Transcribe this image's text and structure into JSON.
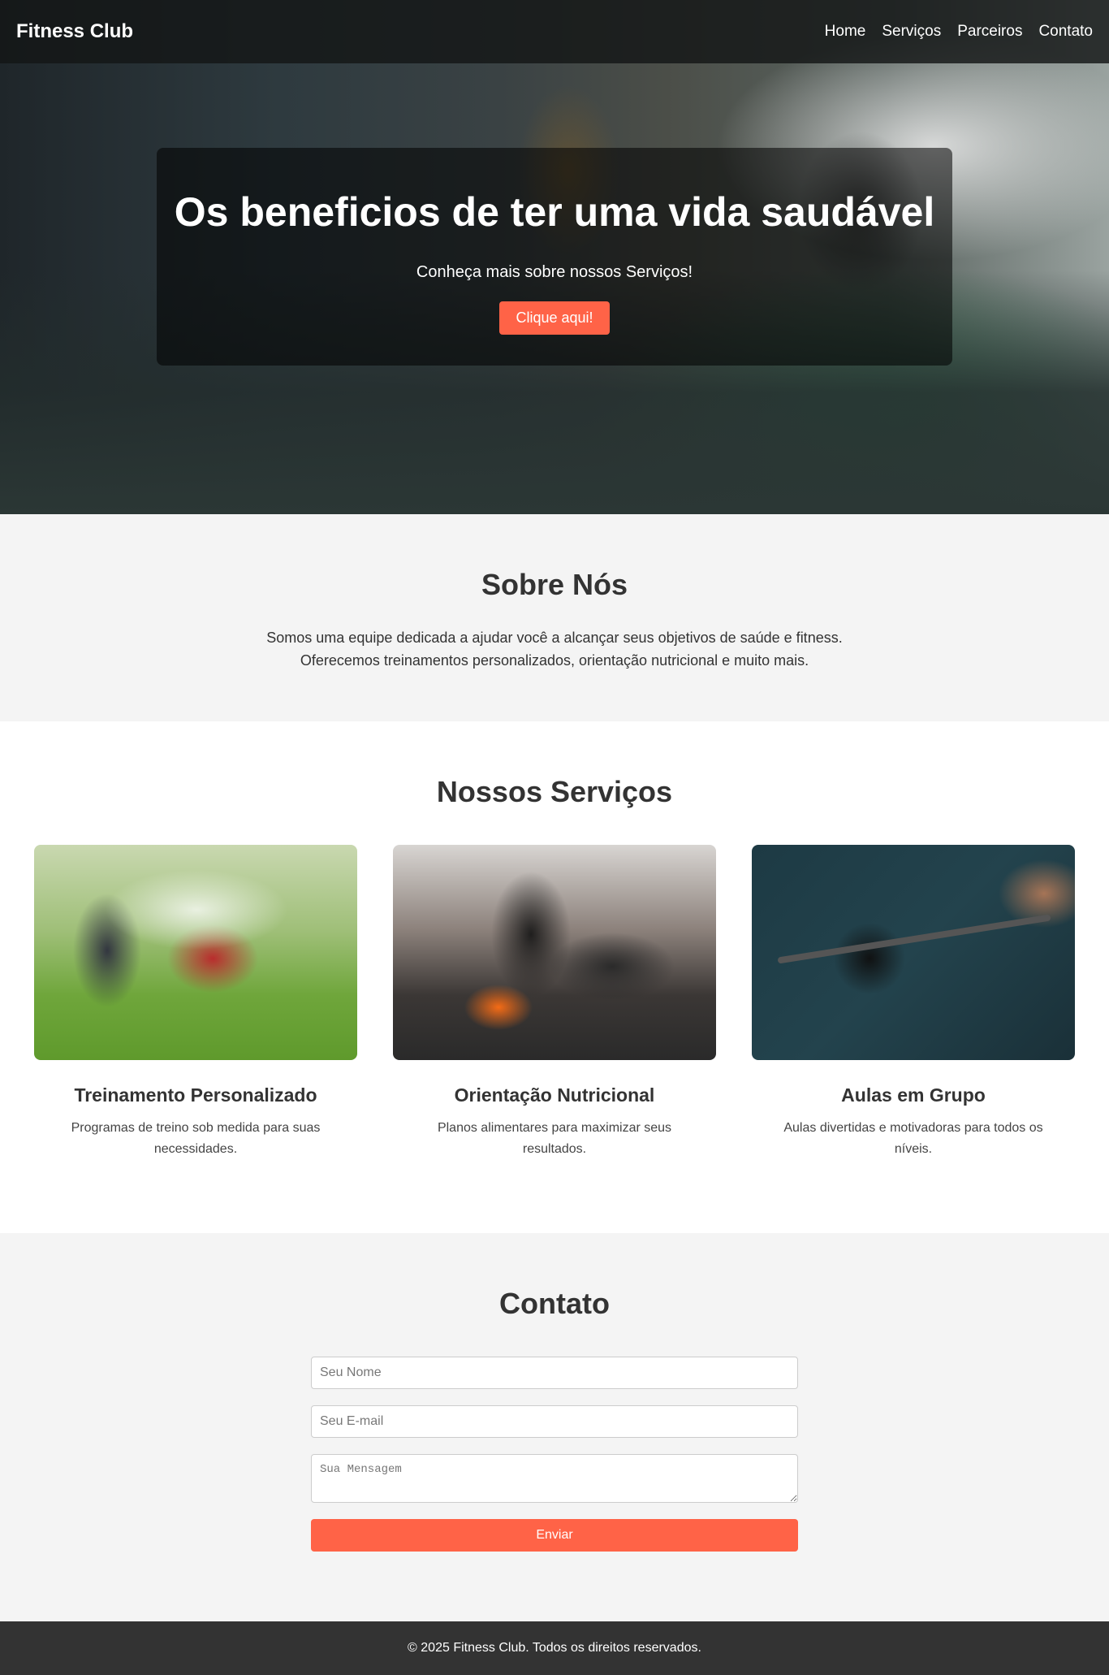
{
  "nav": {
    "brand": "Fitness Club",
    "links": [
      "Home",
      "Serviços",
      "Parceiros",
      "Contato"
    ]
  },
  "hero": {
    "title": "Os beneficios de ter uma vida saudável",
    "subtitle": "Conheça mais sobre nossos Serviços!",
    "button": "Clique aqui!"
  },
  "about": {
    "title": "Sobre Nós",
    "line1": "Somos uma equipe dedicada a ajudar você a alcançar seus objetivos de saúde e fitness.",
    "line2": "Oferecemos treinamentos personalizados, orientação nutricional e muito mais."
  },
  "services": {
    "title": "Nossos Serviços",
    "cards": [
      {
        "title": "Treinamento Personalizado",
        "text": "Programas de treino sob medida para suas necessidades."
      },
      {
        "title": "Orientação Nutricional",
        "text": "Planos alimentares para maximizar seus resultados."
      },
      {
        "title": "Aulas em Grupo",
        "text": "Aulas divertidas e motivadoras para todos os níveis."
      }
    ]
  },
  "contact": {
    "title": "Contato",
    "name_placeholder": "Seu Nome",
    "email_placeholder": "Seu E-mail",
    "message_placeholder": "Sua Mensagem",
    "submit": "Enviar"
  },
  "footer": {
    "text": "© 2025 Fitness Club. Todos os direitos reservados."
  },
  "colors": {
    "accent": "#ff6347",
    "section_bg": "#f4f4f4",
    "footer_bg": "#333333"
  }
}
